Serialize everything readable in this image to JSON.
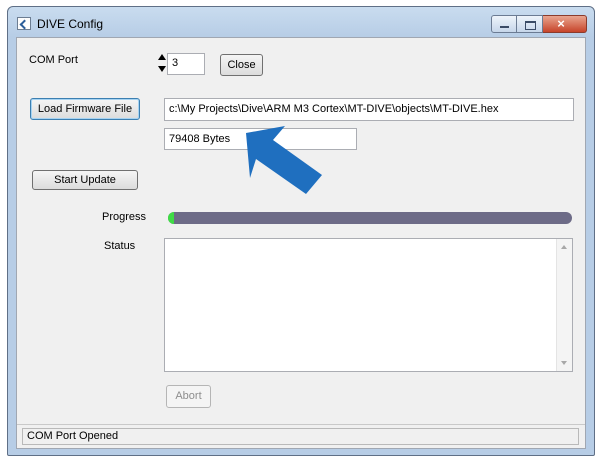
{
  "window": {
    "title": "DIVE Config",
    "close_glyph": "×"
  },
  "com_port": {
    "label": "COM Port",
    "value": "3",
    "close_button": "Close"
  },
  "firmware": {
    "load_button": "Load Firmware File",
    "path": "c:\\My Projects\\Dive\\ARM M3 Cortex\\MT-DIVE\\objects\\MT-DIVE.hex",
    "size": "79408 Bytes"
  },
  "update": {
    "start_button": "Start Update",
    "abort_button": "Abort"
  },
  "progress": {
    "label": "Progress",
    "fraction": 0.014
  },
  "status": {
    "label": "Status",
    "text": ""
  },
  "statusbar": {
    "text": "COM Port Opened"
  },
  "annotation": {
    "icon": "arrow-pointer-icon",
    "color": "#1f6fbf"
  },
  "colors": {
    "progress_track": "#6d6b87",
    "progress_fill": "#3fdc45"
  }
}
